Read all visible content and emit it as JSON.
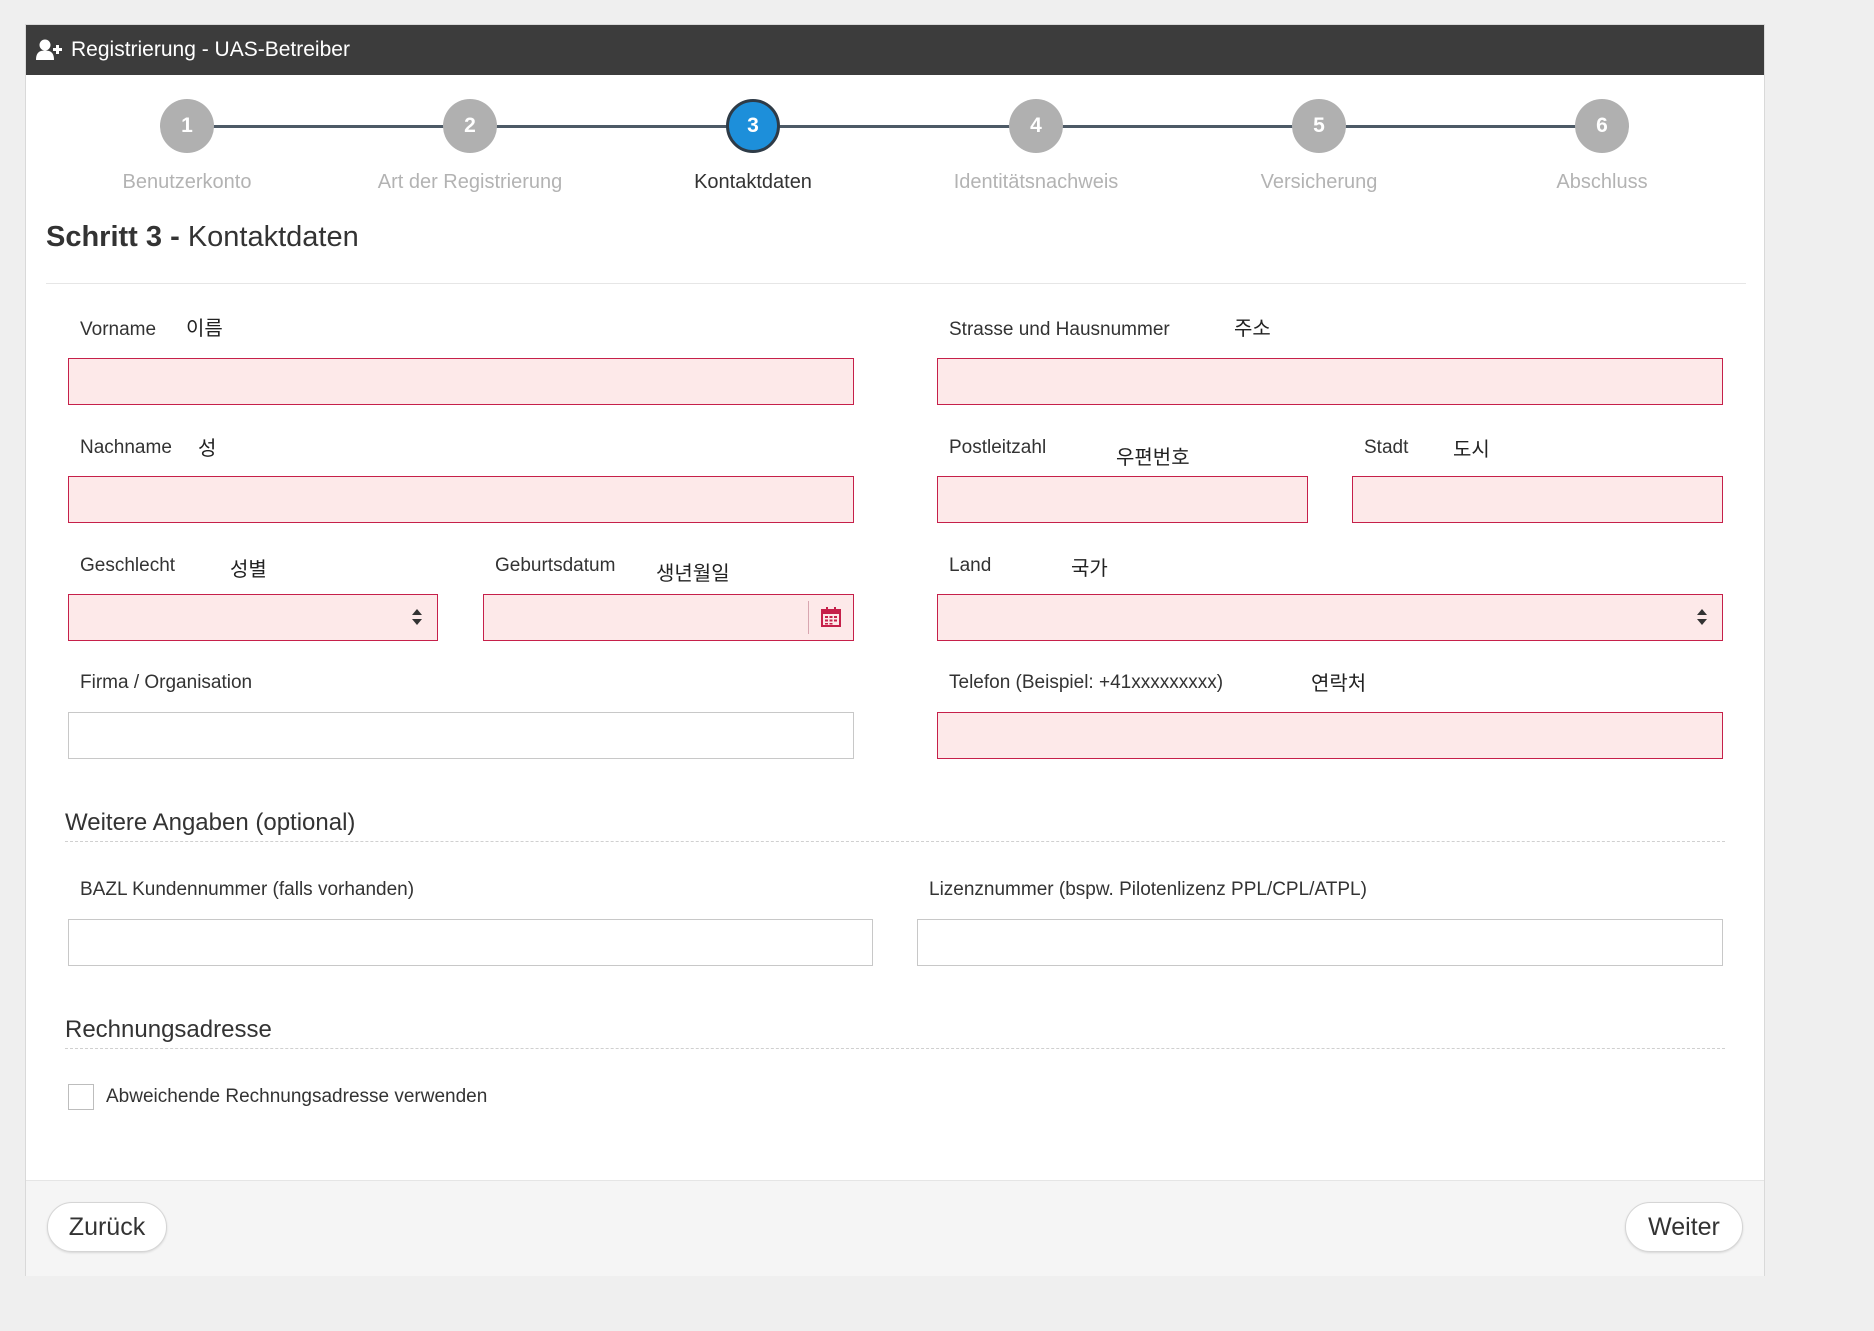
{
  "header": {
    "title": "Registrierung - UAS-Betreiber",
    "icon": "user-plus-icon"
  },
  "wizard": {
    "steps": [
      {
        "number": "1",
        "label": "Benutzerkonto"
      },
      {
        "number": "2",
        "label": "Art der Registrierung"
      },
      {
        "number": "3",
        "label": "Kontaktdaten"
      },
      {
        "number": "4",
        "label": "Identitätsnachweis"
      },
      {
        "number": "5",
        "label": "Versicherung"
      },
      {
        "number": "6",
        "label": "Abschluss"
      }
    ],
    "active_step": 3,
    "colors": {
      "active": "#1d8fda",
      "inactive": "#b0b0b0",
      "line": "#4d5a66"
    }
  },
  "step_title": {
    "prefix": "Schritt 3",
    "separator": " - ",
    "name": "Kontaktdaten"
  },
  "form": {
    "vorname": {
      "label": "Vorname",
      "annotation": "이름",
      "value": ""
    },
    "nachname": {
      "label": "Nachname",
      "annotation": "성",
      "value": ""
    },
    "geschlecht": {
      "label": "Geschlecht",
      "annotation": "성별",
      "value": ""
    },
    "geburtsdatum": {
      "label": "Geburtsdatum",
      "annotation": "생년월일",
      "value": ""
    },
    "firma": {
      "label": "Firma / Organisation",
      "value": ""
    },
    "strasse": {
      "label": "Strasse und Hausnummer",
      "annotation": "주소",
      "value": ""
    },
    "plz": {
      "label": "Postleitzahl",
      "annotation": "우편번호",
      "value": ""
    },
    "stadt": {
      "label": "Stadt",
      "annotation": "도시",
      "value": ""
    },
    "land": {
      "label": "Land",
      "annotation": "국가",
      "value": ""
    },
    "telefon": {
      "label": "Telefon (Beispiel: +41xxxxxxxxx)",
      "annotation": "연락처",
      "value": ""
    }
  },
  "weitere_angaben": {
    "title": "Weitere Angaben (optional)",
    "bazl": {
      "label": "BAZL Kundennummer (falls vorhanden)",
      "value": ""
    },
    "lizenz": {
      "label": "Lizenznummer (bspw. Pilotenlizenz PPL/CPL/ATPL)",
      "value": ""
    }
  },
  "rechnungsadresse": {
    "title": "Rechnungsadresse",
    "checkbox_label": "Abweichende Rechnungsadresse verwenden",
    "checked": false
  },
  "footer": {
    "back_label": "Zurück",
    "next_label": "Weiter"
  },
  "colors": {
    "required_border": "#c6204a",
    "required_bg": "#fde9e9",
    "header_bg": "#3c3c3c"
  }
}
